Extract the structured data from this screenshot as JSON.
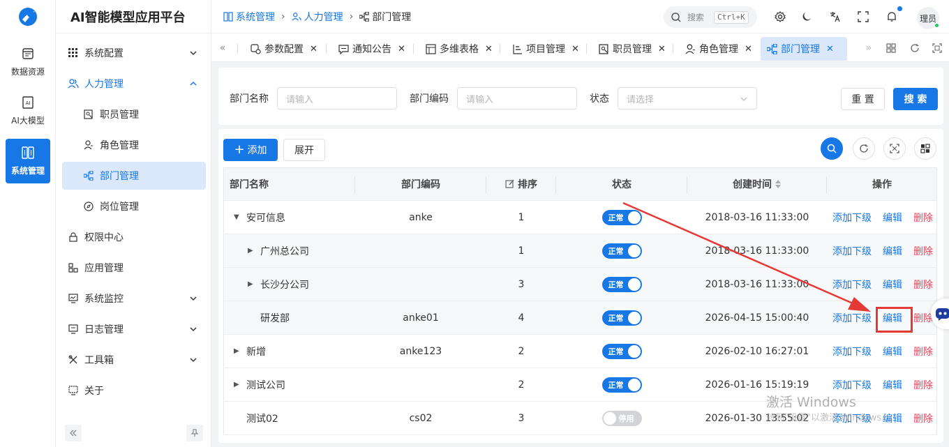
{
  "app": {
    "title": "AI智能模型应用平台"
  },
  "rail": [
    {
      "label": "数据资源",
      "icon": "data-resource-icon"
    },
    {
      "label": "AI大模型",
      "icon": "ai-model-icon"
    },
    {
      "label": "系统管理",
      "icon": "system-manage-icon",
      "active": true
    }
  ],
  "menu": {
    "items": [
      {
        "label": "系统配置",
        "icon": "grid-icon",
        "expandable": true
      },
      {
        "label": "人力管理",
        "icon": "users-icon",
        "expandable": true,
        "open": true
      },
      {
        "label": "职员管理",
        "icon": "staff-icon",
        "sub": true
      },
      {
        "label": "角色管理",
        "icon": "role-icon",
        "sub": true
      },
      {
        "label": "部门管理",
        "icon": "org-chart-icon",
        "sub": true,
        "selected": true
      },
      {
        "label": "岗位管理",
        "icon": "compass-icon",
        "sub": true
      },
      {
        "label": "权限中心",
        "icon": "lock-icon"
      },
      {
        "label": "应用管理",
        "icon": "app-icon"
      },
      {
        "label": "系统监控",
        "icon": "monitor-icon",
        "expandable": true
      },
      {
        "label": "日志管理",
        "icon": "log-icon",
        "expandable": true
      },
      {
        "label": "工具箱",
        "icon": "tools-icon",
        "expandable": true
      },
      {
        "label": "关于",
        "icon": "about-icon"
      }
    ]
  },
  "breadcrumb": [
    "系统管理",
    "人力管理",
    "部门管理"
  ],
  "header": {
    "search_label": "搜索",
    "shortcut": "Ctrl+K",
    "avatar_text": "理员"
  },
  "tabs": [
    {
      "label": "参数配置",
      "icon": "settings-param-icon"
    },
    {
      "label": "通知公告",
      "icon": "message-icon"
    },
    {
      "label": "多维表格",
      "icon": "table-icon"
    },
    {
      "label": "项目管理",
      "icon": "project-icon"
    },
    {
      "label": "职员管理",
      "icon": "staff-icon"
    },
    {
      "label": "角色管理",
      "icon": "role-icon"
    },
    {
      "label": "部门管理",
      "icon": "org-chart-icon",
      "active": true
    }
  ],
  "filter": {
    "name_label": "部门名称",
    "name_placeholder": "请输入",
    "code_label": "部门编码",
    "code_placeholder": "请输入",
    "status_label": "状态",
    "status_placeholder": "请选择",
    "reset": "重 置",
    "search": "搜 索"
  },
  "toolbar": {
    "add": "添加",
    "expand": "展开"
  },
  "table": {
    "columns": [
      "部门名称",
      "部门编码",
      "排序",
      "状态",
      "创建时间",
      "操作"
    ],
    "rows": [
      {
        "name": "安可信息",
        "code": "anke",
        "sort": "1",
        "status": "正常",
        "enabled": true,
        "created": "2018-03-16 11:33:00",
        "caret": "down",
        "indent": 0
      },
      {
        "name": "广州总公司",
        "code": "",
        "sort": "1",
        "status": "正常",
        "enabled": true,
        "created": "2018-03-16 11:33:00",
        "caret": "right",
        "indent": 1
      },
      {
        "name": "长沙分公司",
        "code": "",
        "sort": "3",
        "status": "正常",
        "enabled": true,
        "created": "2018-03-16 11:33:00",
        "caret": "right",
        "indent": 1
      },
      {
        "name": "研发部",
        "code": "anke01",
        "sort": "4",
        "status": "正常",
        "enabled": true,
        "created": "2026-04-15 15:00:40",
        "caret": "none",
        "indent": 1
      },
      {
        "name": "新增",
        "code": "anke123",
        "sort": "2",
        "status": "正常",
        "enabled": true,
        "created": "2026-02-10 16:27:01",
        "caret": "right",
        "indent": 0
      },
      {
        "name": "测试公司",
        "code": "",
        "sort": "2",
        "status": "正常",
        "enabled": true,
        "created": "2026-01-16 15:19:19",
        "caret": "right",
        "indent": 0
      },
      {
        "name": "测试02",
        "code": "cs02",
        "sort": "3",
        "status": "停用",
        "enabled": false,
        "created": "2026-01-30 13:55:02",
        "caret": "none",
        "indent": 0
      }
    ],
    "actions": {
      "add_child": "添加下级",
      "edit": "编辑",
      "delete": "删除"
    }
  },
  "watermark": {
    "line1": "激活 Windows",
    "line2": "转到\"设置\"以激活 Windows。"
  },
  "colors": {
    "primary": "#1677e5",
    "danger": "#e5475b",
    "annotation": "#e53935"
  }
}
